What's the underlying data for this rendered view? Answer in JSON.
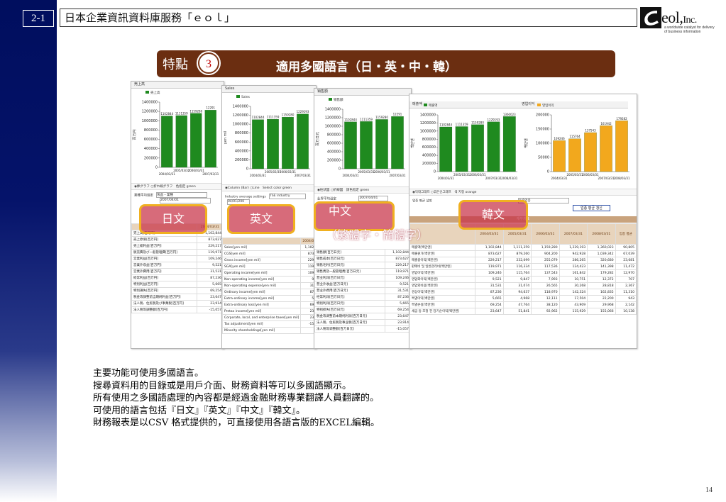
{
  "header": {
    "slide_number": "2-1",
    "title": "日本企業資訊資料庫服務「ｅｏｌ」"
  },
  "logo": {
    "wordmark": "eol,",
    "suffix": "Inc.",
    "tagline": "a worldwide catalyst for delivery of business information"
  },
  "feature": {
    "label": "特點",
    "number": "3",
    "title": "適用多國語言（日・英・中・韓）"
  },
  "languages": {
    "ja": "日文",
    "en": "英文",
    "zh": "中文",
    "zh_sub": "（繁體字・簡體字）",
    "ko": "韓文"
  },
  "screens": {
    "ja": {
      "head": "売上高",
      "legend": "売上高",
      "ylabel": "百万円",
      "controls": "◉棒グラフ ○折れ線グラフ　色指定 green",
      "form_label": "業種平均設定",
      "form_value": "製品・業種",
      "form_date": "2007/04/01",
      "table_header": "2004/03/31",
      "rows": [
        [
          "売上高[百万円]",
          "1,102,844"
        ],
        [
          "売上原価[百万円]",
          "873,627"
        ],
        [
          "売上総利益[百万円]",
          "229,217"
        ],
        [
          "販売費及び一般管理費[百万円]",
          "119,971"
        ],
        [
          "営業利益[百万円]",
          "109,246"
        ],
        [
          "営業外収益[百万円]",
          "9,521"
        ],
        [
          "営業外費用[百万円]",
          "31,531"
        ],
        [
          "経常利益[百万円]",
          "87,236"
        ],
        [
          "特別利益[百万円]",
          "5,665"
        ],
        [
          "特別損失[百万円]",
          "69,254"
        ],
        [
          "税金等調整前当期純利益[百万円]",
          "23,647"
        ],
        [
          "法人税、住民税及び事業税[百万円]",
          "23,914"
        ],
        [
          "法人税等調整額[百万円]",
          "-15,057"
        ]
      ]
    },
    "en": {
      "head": "Sales",
      "legend": "Sales",
      "ylabel": "yen mil",
      "controls": "◉Column (Bar) ○Line　Select color green",
      "form_label": "Industry average settings",
      "form_value": "TSE industry",
      "form_date": "04/01/200",
      "table_header": "2004/03/31",
      "rows": [
        [
          "Sales[yen mil]",
          "1,102,844"
        ],
        [
          "CGS[yen mil]",
          "873,627"
        ],
        [
          "Gross income[yen mil]",
          "229,217"
        ],
        [
          "SGA[yen mil]",
          "119,971"
        ],
        [
          "Operating income[yen mil]",
          "109,246"
        ],
        [
          "Non-operating income[yen mil]",
          "9,521"
        ],
        [
          "Non-operating expense[yen mil]",
          "31,531"
        ],
        [
          "Ordinary income[yen mil]",
          "87,236"
        ],
        [
          "Extra-ordinary income[yen mil]",
          "5,665"
        ],
        [
          "Extra-ordinary loss[yen mil]",
          "69,254"
        ],
        [
          "Pretax income[yen mil]",
          "23,647"
        ],
        [
          "Corporate, local, and enterprise taxes[yen mil]",
          "23,914"
        ],
        [
          "Tax adjustment[yen mil]",
          "-15,057"
        ],
        [
          "Minority shareholdings[yen mil]",
          "335"
        ]
      ]
    },
    "zh": {
      "head": "销售額",
      "legend": "销售額",
      "ylabel": "百万日元",
      "controls": "◉柱状図 ○折線図　顔色指定 green",
      "form_label": "业界平均设定",
      "form_value": "",
      "form_date": "2007/04/01",
      "table_header": "",
      "rows": [
        [
          "销售額[百万日元]",
          "1,102,844"
        ],
        [
          "销售成本[百万日元]",
          "873,627"
        ],
        [
          "销售毛利[百万日元]",
          "229,217"
        ],
        [
          "销售费及一般管理费[百万日元]",
          "119,971"
        ],
        [
          "营业利润[百万日元]",
          "109,246"
        ],
        [
          "营业外收益[百万日元]",
          "9,521"
        ],
        [
          "营业外费用[百万日元]",
          "31,531"
        ],
        [
          "经常利润[百万日元]",
          "87,236"
        ],
        [
          "特别利润[百万日元]",
          "5,665"
        ],
        [
          "特别损失[百万日元]",
          "69,254"
        ],
        [
          "税金等调整前本期纯利润[百万日元]",
          "23,647"
        ],
        [
          "法人税、住民税及事业税[百万日元]",
          "23,914"
        ],
        [
          "法人税等调整额[百万日元]",
          "-15,057"
        ]
      ]
    },
    "ko": {
      "head_a": "매출액",
      "head_b": "영업이익",
      "legend_a": "매출액",
      "legend_b": "영업이익",
      "ylabel": "백만엔",
      "controls": "◉막대그래프 ○꺾은선그래프　색 지정 orange",
      "form_label": "업종 평균 설정",
      "form_value": "동증업종",
      "form_button": "업종 평균 갱신",
      "table_caption": "재무제표",
      "headers": [
        "2004/03/31",
        "2005/03/31",
        "2006/03/31",
        "2007/03/31",
        "2008/03/31",
        "업종 평균"
      ],
      "rows": [
        [
          "매출액[백만엔]",
          "1,102,844",
          "1,111,359",
          "1,159,280",
          "1,229,193",
          "1,360,023",
          "90,805"
        ],
        [
          "매출원가[백만엔]",
          "873,627",
          "879,260",
          "904,200",
          "942,928",
          "1,039,342",
          "67,039"
        ],
        [
          "매출총이익[백만엔]",
          "229,217",
          "232,099",
          "255,079",
          "286,265",
          "320,680",
          "23,681"
        ],
        [
          "판매비 및 일반관리비[백만엔]",
          "119,971",
          "116,334",
          "117,536",
          "124,423",
          "141,398",
          "11,472"
        ],
        [
          "영업이익[백만엔]",
          "109,246",
          "115,764",
          "137,543",
          "161,842",
          "179,282",
          "12,970"
        ],
        [
          "영업외이익[백만엔]",
          "9,521",
          "9,847",
          "7,993",
          "10,751",
          "12,372",
          "707"
        ],
        [
          "영업외비용[백만엔]",
          "31,531",
          "31,074",
          "26,565",
          "30,268",
          "28,818",
          "2,367"
        ],
        [
          "경상이익[백만엔]",
          "87,236",
          "94,637",
          "118,970",
          "142,324",
          "162,835",
          "11,310"
        ],
        [
          "특별이익[백만엔]",
          "5,665",
          "4,968",
          "12,111",
          "17,504",
          "22,200",
          "943"
        ],
        [
          "특별손실[백만엔]",
          "69,254",
          "47,764",
          "38,120",
          "43,909",
          "29,968",
          "2,142"
        ],
        [
          "세금 등 조정 전 당기순이익[백만엔]",
          "23,647",
          "51,841",
          "92,962",
          "115,929",
          "155,066",
          "10,138"
        ]
      ]
    }
  },
  "chart_data": [
    {
      "type": "bar",
      "title": "売上高",
      "categories": [
        "2004/03/31",
        "2005/03/31",
        "2006/03/31",
        "2007/03/31"
      ],
      "values": [
        1102844,
        1111359,
        1159280,
        1229193
      ],
      "data_labels": [
        "1102844",
        "1111359",
        "1159280",
        "12291"
      ],
      "series_name": "売上高",
      "ylabel": "百万円",
      "yticks": [
        0,
        200000,
        400000,
        600000,
        800000,
        1000000,
        1200000,
        1400000
      ],
      "ylim": [
        0,
        1400000
      ],
      "color": "#1f8a1f"
    },
    {
      "type": "bar",
      "title": "Sales",
      "categories": [
        "2004/03/31",
        "2005/03/31",
        "2006/03/31",
        "2007/03/31"
      ],
      "values": [
        1102844,
        1111359,
        1159280,
        1229193
      ],
      "data_labels": [
        "1102844",
        "1111359",
        "1159280",
        "1229193"
      ],
      "series_name": "Sales",
      "ylabel": "yen mil",
      "yticks": [
        0,
        200000,
        400000,
        600000,
        800000,
        1000000,
        1200000,
        1400000
      ],
      "ylim": [
        0,
        1400000
      ],
      "color": "#1f8a1f"
    },
    {
      "type": "bar",
      "title": "销售額",
      "categories": [
        "2004/03/31",
        "2005/03/31",
        "2006/03/31",
        "2007/03/31"
      ],
      "values": [
        1102844,
        1111359,
        1159280,
        1229193
      ],
      "data_labels": [
        "1102844",
        "1111359",
        "1159280",
        "12291"
      ],
      "series_name": "销售額",
      "ylabel": "百万日元",
      "yticks": [
        0,
        200000,
        400000,
        600000,
        800000,
        1000000,
        1200000,
        1400000
      ],
      "ylim": [
        0,
        1400000
      ],
      "color": "#1f8a1f"
    },
    {
      "type": "bar",
      "title": "매출액",
      "categories": [
        "2004/03/31",
        "2005/03/31",
        "2006/03/31",
        "2007/03/31",
        "2008/03/31"
      ],
      "values": [
        1102844,
        1111359,
        1159280,
        1229193,
        1360023
      ],
      "data_labels": [
        "1102844",
        "1111359",
        "1159280",
        "1229193",
        "1360023"
      ],
      "series_name": "매출액",
      "ylabel": "백만엔",
      "yticks": [
        0,
        200000,
        400000,
        600000,
        800000,
        1000000,
        1200000,
        1400000
      ],
      "ylim": [
        0,
        1400000
      ],
      "color": "#1f8a1f"
    },
    {
      "type": "bar",
      "title": "영업이익",
      "categories": [
        "2004/03/31",
        "2005/03/31",
        "2006/03/31",
        "2007/03/31",
        "2008/03/31"
      ],
      "values": [
        109246,
        115764,
        137543,
        161842,
        179282
      ],
      "data_labels": [
        "109246",
        "115764",
        "137543",
        "161942",
        "179282"
      ],
      "series_name": "영업이익",
      "ylabel": "백만엔",
      "yticks": [
        0,
        50000,
        100000,
        150000,
        200000
      ],
      "ylim": [
        0,
        200000
      ],
      "color": "#f2a81d"
    }
  ],
  "body": {
    "lines": [
      "主要功能可使用多國語言。",
      "搜尋資料用的目錄或是用戶介面、財務資料等可以多國語顯示。",
      "所有使用之多國語處理的內容都是經過金融財務專業翻譯人員翻譯的。",
      "可使用的語言包括『日文』『英文』『中文』『韓文』。",
      "財務報表是以CSV 格式提供的，可直接使用各語言版的EXCEL編輯。"
    ]
  },
  "page_number": "14"
}
